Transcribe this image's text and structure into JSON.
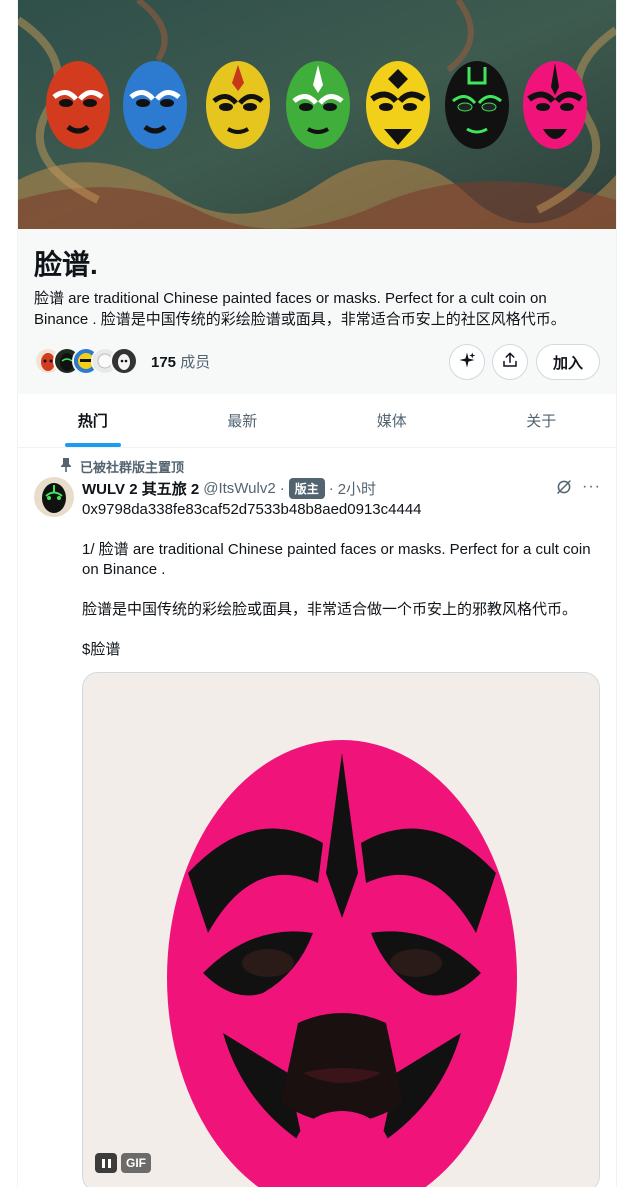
{
  "community": {
    "name": "脸谱.",
    "description": "脸谱 are traditional Chinese painted faces or masks. Perfect for a cult coin on Binance . 脸谱是中国传统的彩绘脸谱或面具，非常适合币安上的社区风格代币。",
    "member_count": "175",
    "member_label": "成员",
    "join_label": "加入"
  },
  "tabs": [
    {
      "label": "热门",
      "active": true
    },
    {
      "label": "最新",
      "active": false
    },
    {
      "label": "媒体",
      "active": false
    },
    {
      "label": "关于",
      "active": false
    }
  ],
  "post": {
    "pinned_label": "已被社群版主置顶",
    "display_name": "WULV 2 其五旅 2",
    "handle": "@ItsWulv2",
    "role_badge": "版主",
    "time": "2小时",
    "lines": [
      "0x9798da338fe83caf52d7533b48b8aed0913c4444",
      "",
      "1/ 脸谱 are traditional Chinese painted faces or masks. Perfect for a cult coin on Binance .",
      "",
      "脸谱是中国传统的彩绘脸或面具，非常适合做一个币安上的邪教风格代币。",
      "",
      "$脸谱"
    ],
    "media": {
      "type": "gif",
      "badge": "GIF"
    }
  },
  "colors": {
    "accent": "#1d9bf0",
    "text": "#0f1419",
    "secondary": "#536471",
    "mask_pink": "#f0147a"
  },
  "icons": [
    "pin-icon",
    "grok-icon",
    "more-icon",
    "sparkle-icon",
    "share-icon",
    "pause-icon"
  ]
}
